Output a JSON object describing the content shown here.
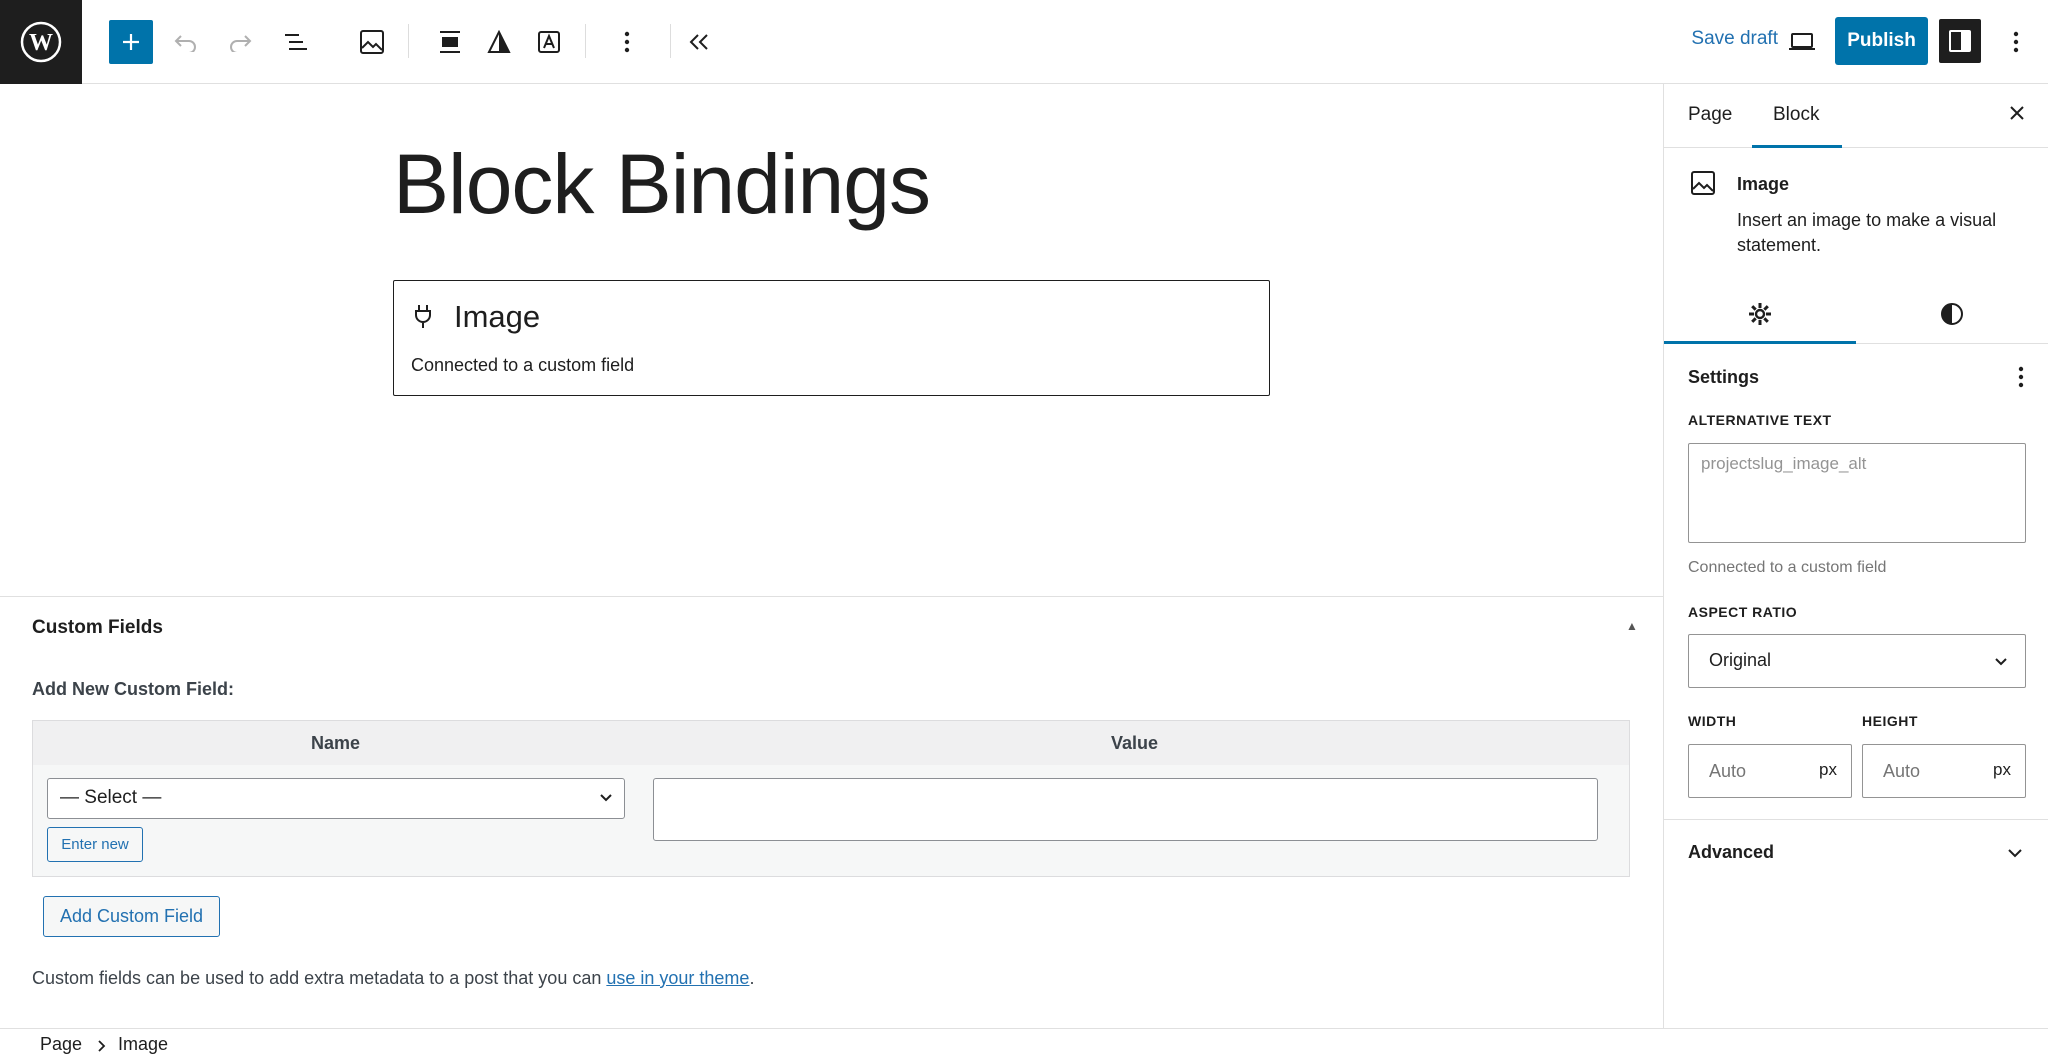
{
  "topbar": {
    "save_draft": "Save draft",
    "publish": "Publish",
    "icons": [
      "wordpress-logo",
      "add-block",
      "undo",
      "redo",
      "document-overview",
      "image-block",
      "align",
      "duotone",
      "text-overlay",
      "more-options",
      "collapse",
      "preview-desktop",
      "settings-toggle",
      "options"
    ]
  },
  "editor": {
    "title": "Block Bindings",
    "placeholder": {
      "label": "Image",
      "sublabel": "Connected to a custom field"
    }
  },
  "metabox": {
    "title": "Custom Fields",
    "add_new_label": "Add New Custom Field:",
    "name_header": "Name",
    "value_header": "Value",
    "select_value": "— Select —",
    "enter_new": "Enter new",
    "add_button": "Add Custom Field",
    "note_before": "Custom fields can be used to add extra metadata to a post that you can ",
    "note_link": "use in your theme",
    "note_after": "."
  },
  "breadcrumb": {
    "items": [
      "Page",
      "Image"
    ]
  },
  "sidebar": {
    "tabs": [
      "Page",
      "Block"
    ],
    "active_tab": "Block",
    "block": {
      "name": "Image",
      "description": "Insert an image to make a visual statement."
    },
    "settings_title": "Settings",
    "alt_text_label": "ALTERNATIVE TEXT",
    "alt_text_value": "projectslug_image_alt",
    "alt_help": "Connected to a custom field",
    "aspect_label": "ASPECT RATIO",
    "aspect_value": "Original",
    "width_label": "WIDTH",
    "height_label": "HEIGHT",
    "width_placeholder": "Auto",
    "height_placeholder": "Auto",
    "unit": "px",
    "advanced": "Advanced"
  },
  "colors": {
    "accent": "#0073aa",
    "link": "#2271b1",
    "dark": "#1e1e1e"
  }
}
